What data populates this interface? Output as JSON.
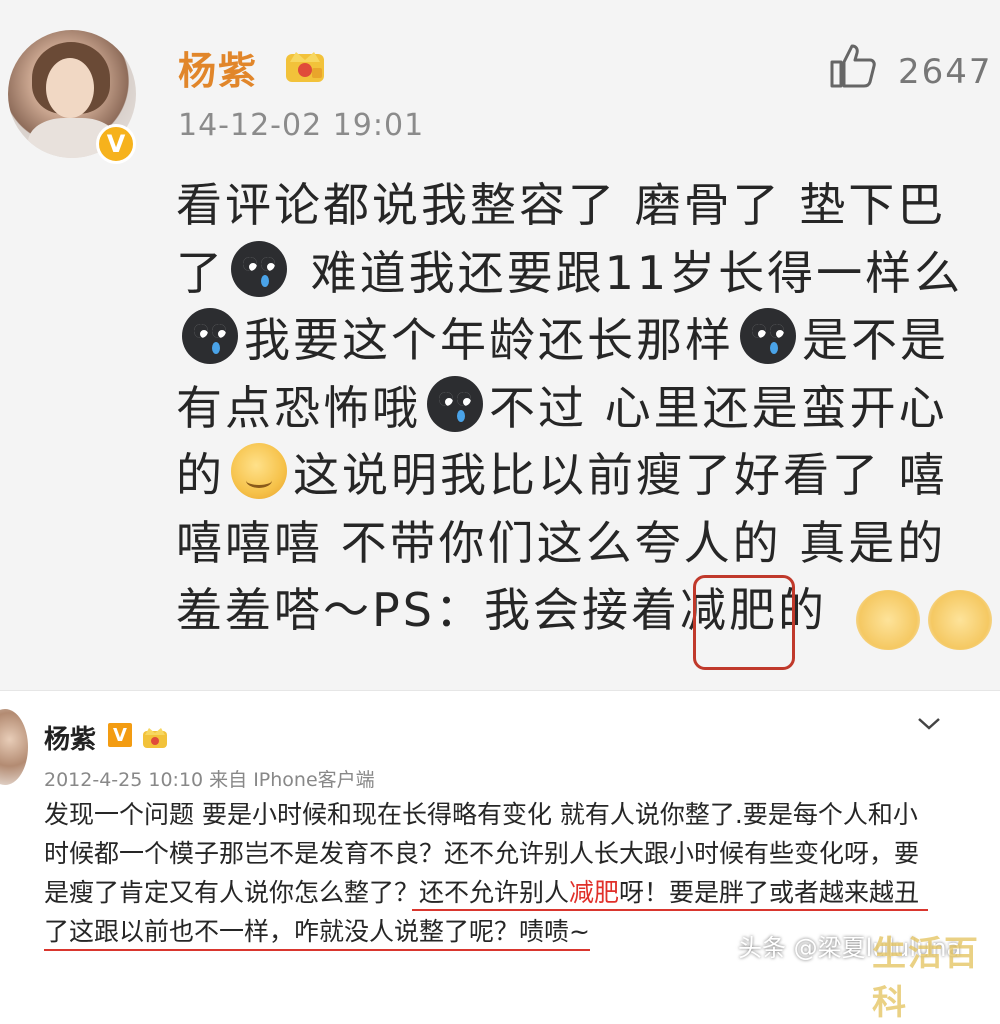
{
  "post1": {
    "author": "杨紫",
    "verified_badge": "V",
    "timestamp": "14-12-02 19:01",
    "like_count": "2647",
    "lines": [
      "看评论都说我整容了 磨骨了 垫下巴",
      [
        "了",
        "难道我还要跟11岁长得一样么"
      ],
      [
        "我要这个年龄还长那样",
        "是不是"
      ],
      [
        "有点恐怖哦",
        "不过 心里还是蛮开心"
      ],
      [
        "的",
        "这说明我比以前瘦了好看了 嘻"
      ],
      "嘻嘻嘻 不带你们这么夸人的 真是的",
      [
        "羞羞嗒～PS：我会接着",
        "减肥",
        "的"
      ]
    ],
    "highlighted_word": "减肥"
  },
  "post2": {
    "author": "杨紫",
    "verified_badge": "V",
    "timestamp": "2012-4-25 10:10 来自 IPhone客户端",
    "lines": [
      "发现一个问题 要是小时候和现在长得略有变化 就有人说你整了.要是每个人和小",
      "时候都一个模子那岂不是发育不良？还不允许别人长大跟小时候有些变化呀，要",
      [
        "是瘦了肯定又有人说你怎么整了？还不允许别人",
        "减肥",
        "呀！要是胖了或者越来越丑"
      ],
      "了这跟以前也不一样，咋就没人说整了呢？啧啧~"
    ]
  },
  "watermark": {
    "toutiao": "头条 @梁夏lululuna",
    "shenghuo": "生活百科"
  },
  "colors": {
    "name_orange": "#e1862a",
    "highlight_red": "#e0302a",
    "box_red": "#c0392b",
    "badge_gold": "#f6b21c"
  },
  "icons": [
    "crown-icon",
    "verified-icon",
    "thumbs-up-icon",
    "cry-emoji-icon",
    "smile-emoji-icon",
    "chevron-down-icon"
  ]
}
